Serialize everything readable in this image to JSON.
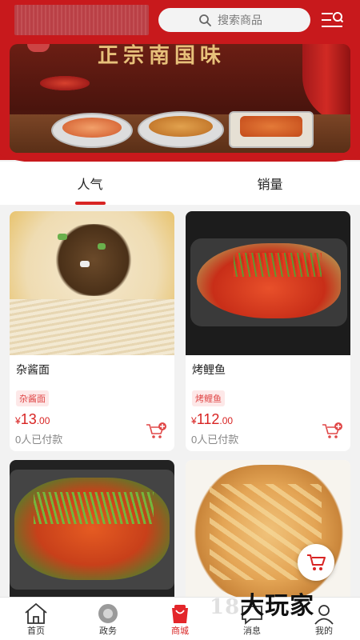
{
  "header": {
    "store_name": "",
    "search_placeholder": "搜索商品"
  },
  "banner": {
    "title": "正宗南国味"
  },
  "tabs": [
    {
      "label": "人气",
      "active": true
    },
    {
      "label": "销量",
      "active": false
    }
  ],
  "products": [
    {
      "name": "杂酱面",
      "tag": "杂酱面",
      "currency": "¥",
      "price_int": "13",
      "price_dec": ".00",
      "sold": "0人已付款"
    },
    {
      "name": "烤鲤鱼",
      "tag": "烤鲤鱼",
      "currency": "¥",
      "price_int": "112",
      "price_dec": ".00",
      "sold": "0人已付款"
    },
    {
      "name": "",
      "tag": "",
      "currency": "",
      "price_int": "",
      "price_dec": "",
      "sold": ""
    },
    {
      "name": "",
      "tag": "",
      "currency": "",
      "price_int": "",
      "price_dec": "",
      "sold": ""
    }
  ],
  "bottom_nav": [
    {
      "label": "首页",
      "icon": "home-icon"
    },
    {
      "label": "政务",
      "icon": "gov-icon"
    },
    {
      "label": "商城",
      "icon": "mall-icon",
      "active": true
    },
    {
      "label": "消息",
      "icon": "message-icon"
    },
    {
      "label": "我的",
      "icon": "profile-icon"
    }
  ],
  "watermark": {
    "text": "大玩家",
    "light_text": "18"
  },
  "colors": {
    "brand_red": "#c8191c",
    "price_red": "#d82423",
    "tag_bg": "#fde8e8"
  }
}
